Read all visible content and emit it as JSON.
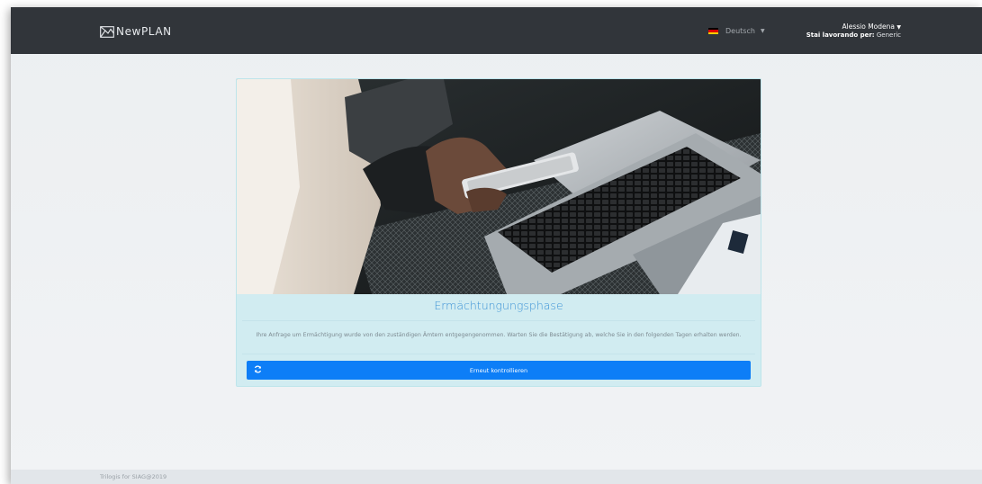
{
  "header": {
    "brand": "NewPLAN",
    "language": "Deutsch",
    "user_name": "Alessio Modena",
    "working_for_label": "Stai lavorando per:",
    "working_for_value": "Generic"
  },
  "card": {
    "title": "Ermächtungungsphase",
    "text": "Ihre Anfrage um Ermächtigung wurde von den zuständigen Ämtern entgegengenommen. Warten Sie die Bestätigung ab, welche Sie in den folgenden Tagen erhalten werden.",
    "button_label": "Erneut kontrollieren"
  },
  "footer": {
    "text": "Trilogis for SIAG@2019"
  },
  "colors": {
    "navbar": "#31353a",
    "card_bg": "#d1ecf1",
    "title": "#3d93d6",
    "button": "#0d7ef7"
  },
  "icons": {
    "brand": "newplan-logo-icon",
    "language": "german-flag-icon",
    "dropdown": "caret-down-icon",
    "button": "refresh-icon"
  }
}
